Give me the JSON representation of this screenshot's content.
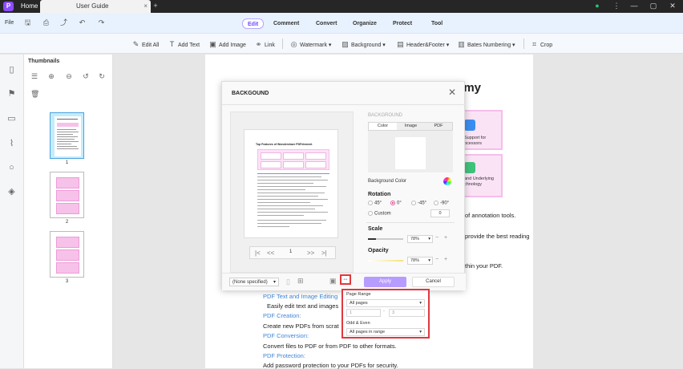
{
  "titlebar": {
    "logo": "P",
    "home_tab": "Home",
    "doc_tab": "User Guide",
    "close_tab": "×",
    "add_tab": "+",
    "minimize": "—",
    "maximize": "▢",
    "close_window": "✕"
  },
  "menu": {
    "file": "File",
    "tabs": [
      "Edit",
      "Comment",
      "Convert",
      "Organize",
      "Protect",
      "Tool"
    ],
    "active_tab": "Edit"
  },
  "toolbar": {
    "edit_all": "Edit All",
    "add_text": "Add Text",
    "add_image": "Add Image",
    "link": "Link",
    "watermark": "Watermark",
    "background": "Background",
    "header_footer": "Header&Footer",
    "bates": "Bates Numbering",
    "crop": "Crop"
  },
  "thumbnails": {
    "title": "Thumbnails",
    "pages": [
      "1",
      "2",
      "3"
    ]
  },
  "document": {
    "heading_fragment": "emy",
    "card1_a": "Support for",
    "card1_b": "ocessors",
    "card2_a": "and Underlying",
    "card2_b": "chnology",
    "line1": "of annotation tools.",
    "line2": "provide the best reading",
    "line3": "thin your PDF.",
    "link1": "PDF Text and Image Editing",
    "text1": "Easily edit text and images",
    "link2": "PDF Creation:",
    "text2": "Create new PDFs from scrat",
    "link3": "PDF Conversion:",
    "text3": "Convert files to PDF or from PDF to other formats.",
    "link4": "PDF Protection:",
    "text4": "Add password protection to your PDFs for security."
  },
  "dialog": {
    "title": "BACKGOUND",
    "close": "✕",
    "preview_title": "Top Features of Wondershare PDFelement",
    "pager": {
      "first": "|<",
      "prev": "<<",
      "page": "1",
      "next": ">>",
      "last": ">|"
    },
    "preset": "(None specified)",
    "apply": "Apply",
    "cancel": "Cancel",
    "background_label": "BACKGROUND",
    "bg_tabs": [
      "Color",
      "Image",
      "PDF"
    ],
    "background_color": "Background Color",
    "rotation": "Rotation",
    "rotations": [
      "45°",
      "0°",
      "-45°",
      "-90°"
    ],
    "custom": "Custom",
    "custom_value": "0",
    "scale": "Scale",
    "scale_value": "78%",
    "opacity": "Opacity",
    "opacity_value": "78%"
  },
  "range_popup": {
    "page_range": "Page Range",
    "all_pages": "All pages",
    "from": "1",
    "dash": "-",
    "to": "3",
    "odd_even": "Odd & Even",
    "odd_even_value": "All pages in range"
  }
}
